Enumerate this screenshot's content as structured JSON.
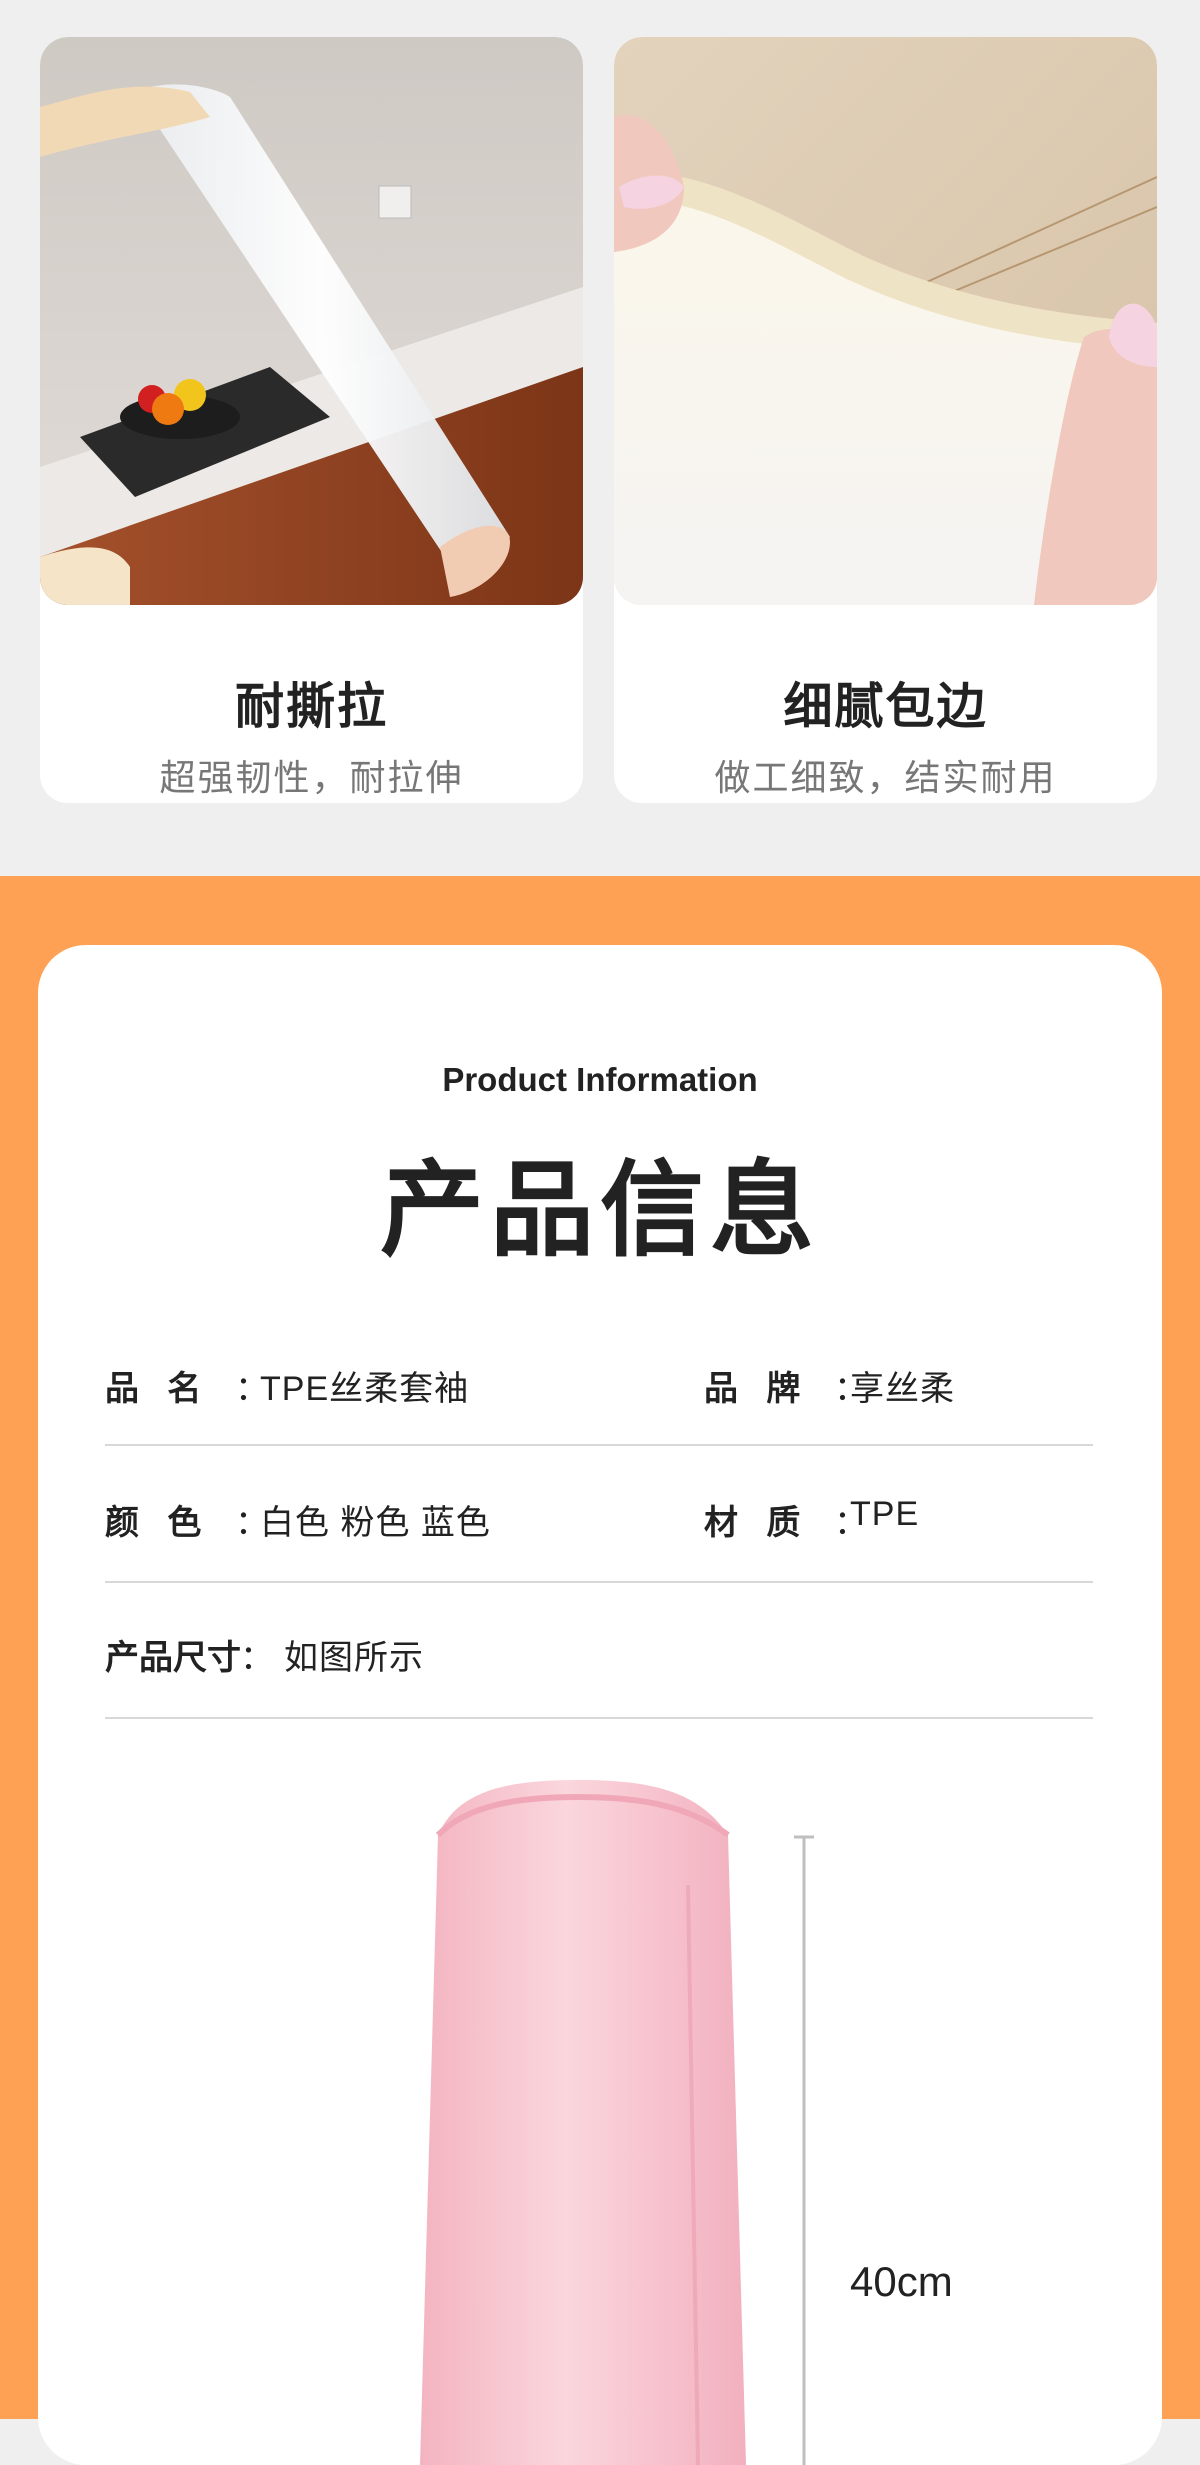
{
  "features": [
    {
      "title": "耐撕拉",
      "subtitle": "超强韧性，耐拉伸",
      "image": "white-sleeve-stretched-kitchen"
    },
    {
      "title": "细腻包边",
      "subtitle": "做工细致，结实耐用",
      "image": "elastic-cuff-closeup"
    }
  ],
  "product_info": {
    "heading_en": "Product Information",
    "heading_cn": "产品信息",
    "specs": {
      "name_label": "品   名",
      "name_value": "TPE丝柔套袖",
      "brand_label": "品   牌",
      "brand_value": "享丝柔",
      "color_label": "颜   色",
      "color_value": "白色 粉色 蓝色",
      "material_label": "材   质",
      "material_value": "TPE",
      "size_label": "产品尺寸",
      "size_value": "如图所示"
    },
    "colon": "：",
    "dimension": "40cm"
  },
  "colors": {
    "accent_band": "#ffa154",
    "page_bg": "#efefef",
    "sleeve_pink": "#f7c6cf"
  }
}
